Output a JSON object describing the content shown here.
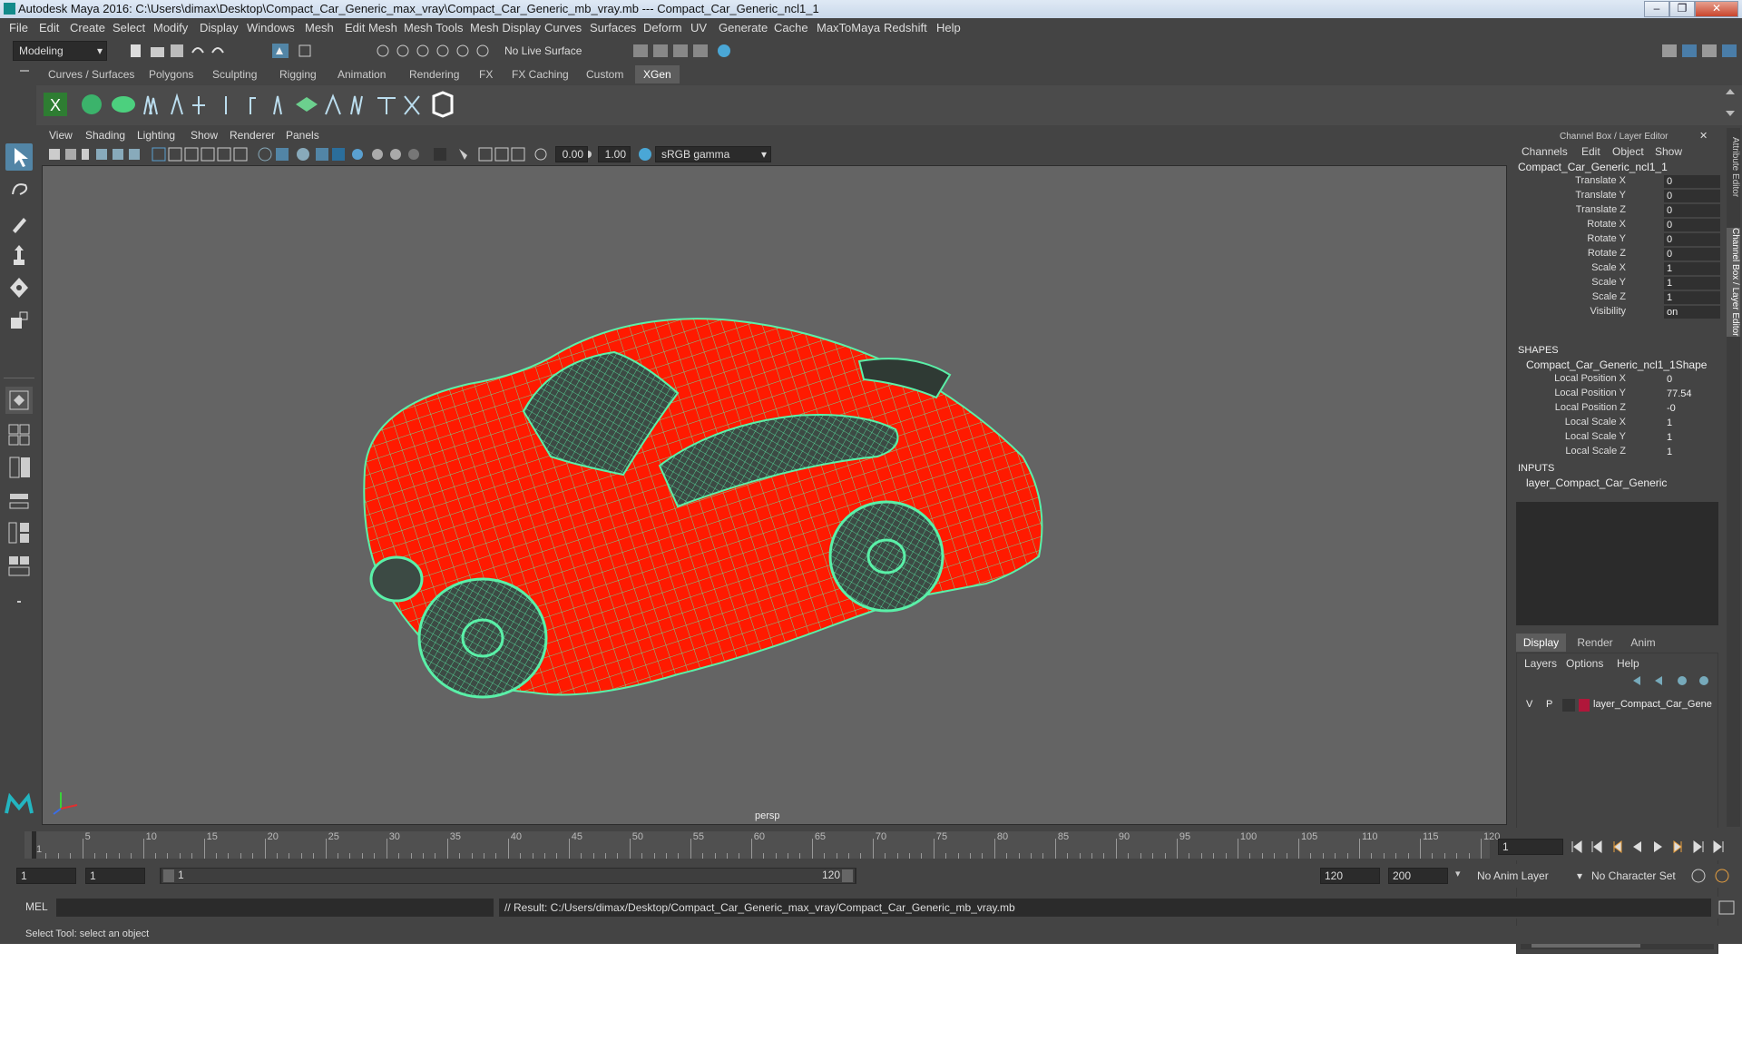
{
  "window": {
    "title": "Autodesk Maya 2016: C:\\Users\\dimax\\Desktop\\Compact_Car_Generic_max_vray\\Compact_Car_Generic_mb_vray.mb   ---   Compact_Car_Generic_ncl1_1",
    "btn_minimize": "–",
    "btn_maximize": "❐",
    "btn_close": "✕"
  },
  "menubar": [
    "File",
    "Edit",
    "Create",
    "Select",
    "Modify",
    "Display",
    "Windows",
    "Mesh",
    "Edit Mesh",
    "Mesh Tools",
    "Mesh Display",
    "Curves",
    "Surfaces",
    "Deform",
    "UV",
    "Generate",
    "Cache",
    "MaxToMaya",
    "Redshift",
    "Help"
  ],
  "status_line": {
    "mode": "Modeling",
    "live_surface": "No Live Surface"
  },
  "shelf_tabs": [
    "Curves / Surfaces",
    "Polygons",
    "Sculpting",
    "Rigging",
    "Animation",
    "Rendering",
    "FX",
    "FX Caching",
    "Custom",
    "XGen"
  ],
  "active_shelf_tab": "XGen",
  "viewport": {
    "menu": [
      "View",
      "Shading",
      "Lighting",
      "Show",
      "Renderer",
      "Panels"
    ],
    "exposure": "0.00",
    "gamma": "1.00",
    "color_space": "sRGB gamma",
    "camera_label": "persp"
  },
  "channel_box": {
    "title": "Channel Box / Layer Editor",
    "menu": [
      "Channels",
      "Edit",
      "Object",
      "Show"
    ],
    "object_name": "Compact_Car_Generic_ncl1_1",
    "channels": [
      {
        "label": "Translate X",
        "value": "0"
      },
      {
        "label": "Translate Y",
        "value": "0"
      },
      {
        "label": "Translate Z",
        "value": "0"
      },
      {
        "label": "Rotate X",
        "value": "0"
      },
      {
        "label": "Rotate Y",
        "value": "0"
      },
      {
        "label": "Rotate Z",
        "value": "0"
      },
      {
        "label": "Scale X",
        "value": "1"
      },
      {
        "label": "Scale Y",
        "value": "1"
      },
      {
        "label": "Scale Z",
        "value": "1"
      },
      {
        "label": "Visibility",
        "value": "on"
      }
    ],
    "shapes_header": "SHAPES",
    "shape_name": "Compact_Car_Generic_ncl1_1Shape",
    "shape_channels": [
      {
        "label": "Local Position X",
        "value": "0"
      },
      {
        "label": "Local Position Y",
        "value": "77.54"
      },
      {
        "label": "Local Position Z",
        "value": "-0"
      },
      {
        "label": "Local Scale X",
        "value": "1"
      },
      {
        "label": "Local Scale Y",
        "value": "1"
      },
      {
        "label": "Local Scale Z",
        "value": "1"
      }
    ],
    "inputs_header": "INPUTS",
    "input_name": "layer_Compact_Car_Generic"
  },
  "layer_editor": {
    "tabs": [
      "Display",
      "Render",
      "Anim"
    ],
    "active_tab": "Display",
    "menu": [
      "Layers",
      "Options",
      "Help"
    ],
    "layer": {
      "v": "V",
      "p": "P",
      "name": "layer_Compact_Car_Gene",
      "color": "#b0173a"
    }
  },
  "side_tabs": [
    "Attribute Editor",
    "Channel Box / Layer Editor"
  ],
  "time_slider": {
    "ticks": [
      "1",
      "5",
      "10",
      "15",
      "20",
      "25",
      "30",
      "35",
      "40",
      "45",
      "50",
      "55",
      "60",
      "65",
      "70",
      "75",
      "80",
      "85",
      "90",
      "95",
      "100",
      "105",
      "110",
      "115",
      "120"
    ],
    "current_frame": "1"
  },
  "range_slider": {
    "start": "1",
    "anim_start": "1",
    "range_start": "1",
    "range_end": "120",
    "anim_end": "120",
    "end": "200",
    "anim_layer": "No Anim Layer",
    "character_set": "No Character Set"
  },
  "command_line": {
    "language": "MEL",
    "result": "// Result: C:/Users/dimax/Desktop/Compact_Car_Generic_max_vray/Compact_Car_Generic_mb_vray.mb"
  },
  "help_line": "Select Tool: select an object",
  "colors": {
    "car_body": "#ff1a00",
    "wireframe": "#5af0a8",
    "accent": "#5285a6"
  }
}
